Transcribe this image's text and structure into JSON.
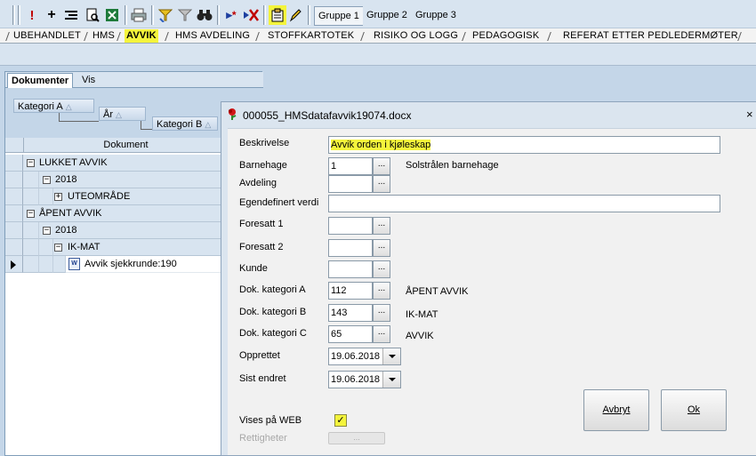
{
  "toolbar": {
    "icons": [
      "exclamation-icon",
      "plus-icon",
      "indent-icon",
      "print-preview-icon",
      "excel-icon",
      "printer-icon",
      "filter-icon",
      "filter-clear-icon",
      "binoculars-icon",
      "star-mark-icon",
      "cross-mark-icon",
      "notes-icon",
      "pencil-icon"
    ],
    "groups": [
      "Gruppe 1",
      "Gruppe 2",
      "Gruppe 3"
    ]
  },
  "module_tabs": [
    "UBEHANDLET",
    "HMS",
    "AVVIK",
    "HMS AVDELING",
    "STOFFKARTOTEK",
    "RISIKO OG LOGG",
    "PEDAGOGISK",
    "REFERAT ETTER PEDLEDERMØTER"
  ],
  "left_panel": {
    "tabs": [
      "Dokumenter",
      "Vis"
    ],
    "group_chips": [
      "Kategori A",
      "År",
      "Kategori B"
    ],
    "column_header": "Dokument",
    "rows": [
      {
        "level": 0,
        "expander": "−",
        "text": "LUKKET AVVIK"
      },
      {
        "level": 1,
        "expander": "−",
        "text": "2018"
      },
      {
        "level": 2,
        "expander": "+",
        "text": "UTEOMRÅDE"
      },
      {
        "level": 0,
        "expander": "−",
        "text": "ÅPENT AVVIK"
      },
      {
        "level": 1,
        "expander": "−",
        "text": "2018"
      },
      {
        "level": 2,
        "expander": "−",
        "text": "IK-MAT"
      },
      {
        "level": 3,
        "expander": "",
        "text": "Avvik sjekkrunde:190"
      }
    ]
  },
  "dialog": {
    "title": "000055_HMSdatafavvik19074.docx",
    "close": "×",
    "labels": {
      "beskrivelse": "Beskrivelse",
      "barnehage": "Barnehage",
      "avdeling": "Avdeling",
      "egendefinert": "Egendefinert verdi",
      "foresatt1": "Foresatt 1",
      "foresatt2": "Foresatt 2",
      "kunde": "Kunde",
      "dok_a": "Dok. kategori A",
      "dok_b": "Dok. kategori B",
      "dok_c": "Dok. kategori C",
      "opprettet": "Opprettet",
      "sist_endret": "Sist endret",
      "vises_web": "Vises på WEB",
      "rettigheter": "Rettigheter"
    },
    "values": {
      "beskrivelse": "Avvik orden i kjøleskap",
      "barnehage": "1",
      "barnehage_name": "Solstrålen barnehage",
      "avdeling": "",
      "egendefinert": "",
      "foresatt1": "",
      "foresatt2": "",
      "kunde": "",
      "dok_a": "112",
      "dok_a_name": "ÅPENT AVVIK",
      "dok_b": "143",
      "dok_b_name": "IK-MAT",
      "dok_c": "65",
      "dok_c_name": "AVVIK",
      "opprettet": "19.06.2018",
      "sist_endret": "19.06.2018",
      "vises_web": true
    },
    "ellipsis": "...",
    "buttons": {
      "avbryt": "Avbryt",
      "ok": "Ok",
      "rettigheter": "..."
    },
    "highlight_color": "#f4f43c"
  }
}
